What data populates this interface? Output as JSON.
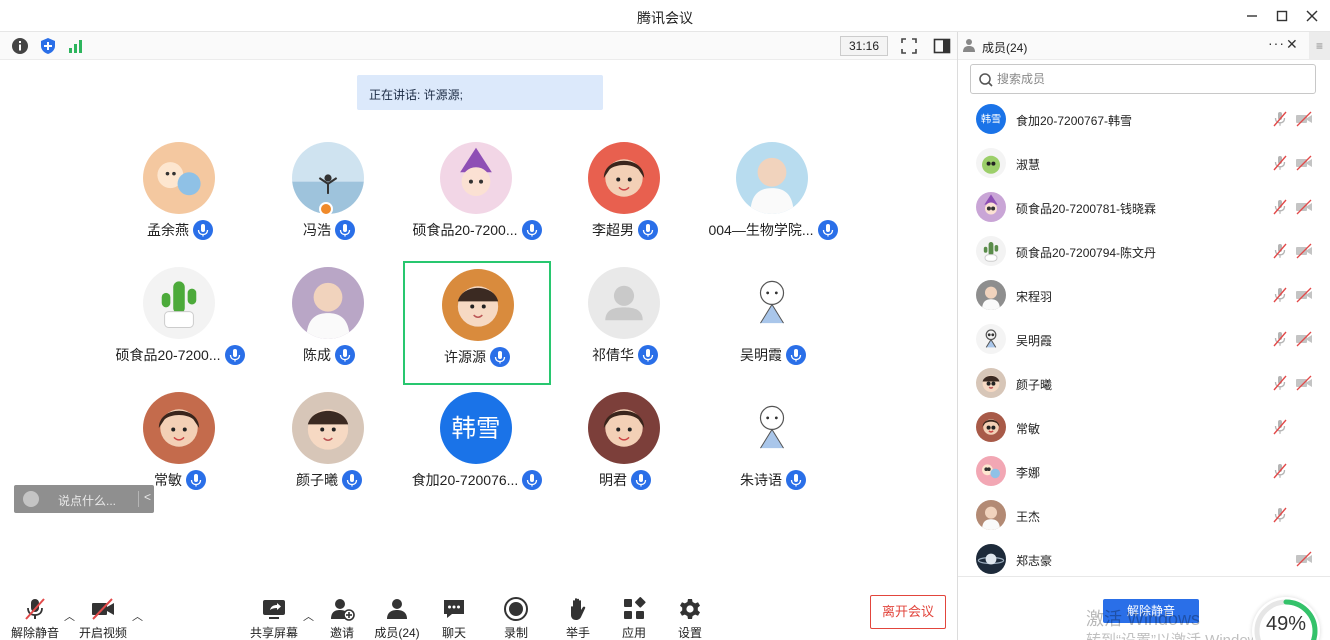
{
  "window": {
    "title": "腾讯会议",
    "controls": [
      "minimize-icon",
      "maximize-icon",
      "close-icon"
    ]
  },
  "topbar": {
    "icons": [
      "info-icon",
      "shield-icon",
      "signal-icon"
    ],
    "timer": "31:16",
    "right_icons": [
      "fullscreen-icon",
      "sidebar-toggle-icon"
    ]
  },
  "speaking": {
    "label": "正在讲话: 许源源;"
  },
  "participants": [
    {
      "name": "孟余燕",
      "avatar": "cartoon",
      "bg": "#f4c8a0"
    },
    {
      "name": "冯浩",
      "avatar": "sea",
      "bg": "#9ec3dc",
      "host": true
    },
    {
      "name": "硕食品20-7200...",
      "avatar": "witch",
      "bg": "#f2d6e6"
    },
    {
      "name": "李超男",
      "avatar": "girl",
      "bg": "#e8604f"
    },
    {
      "name": "004—生物学院...",
      "avatar": "photo",
      "bg": "#b8dcef"
    },
    {
      "name": "硕食品20-7200...",
      "avatar": "cactus",
      "bg": "#4caa3a"
    },
    {
      "name": "陈成",
      "avatar": "photo",
      "bg": "#b9a6c6"
    },
    {
      "name": "许源源",
      "avatar": "baby",
      "bg": "#d98b3d",
      "active": true
    },
    {
      "name": "祁倩华",
      "avatar": "default",
      "bg": "#e9e9e9"
    },
    {
      "name": "吴明霞",
      "avatar": "sketch",
      "bg": "#ffffff"
    },
    {
      "name": "常敏",
      "avatar": "girl",
      "bg": "#c46b4c"
    },
    {
      "name": "颜子曦",
      "avatar": "baby",
      "bg": "#d7c6b8"
    },
    {
      "name": "食加20-720076...",
      "avatar": "text",
      "text": "韩雪",
      "bg": "#1a73e8"
    },
    {
      "name": "明君",
      "avatar": "girl",
      "bg": "#7c3f3a"
    },
    {
      "name": "朱诗语",
      "avatar": "sketch",
      "bg": "#ffffff"
    }
  ],
  "chat": {
    "placeholder": "说点什么...",
    "collapse": "<"
  },
  "bottombar": {
    "unmute": "解除静音",
    "video": "开启视频",
    "share": "共享屏幕",
    "invite": "邀请",
    "members": "成员(24)",
    "chat": "聊天",
    "record": "录制",
    "raise_hand": "举手",
    "apps": "应用",
    "settings": "设置",
    "leave": "离开会议"
  },
  "panel": {
    "title": "成员(24)",
    "more": "···",
    "close": "✕",
    "menu": "≡",
    "search_placeholder": "搜索成员",
    "members": [
      {
        "name": "食加20-7200767-韩雪",
        "avatar": "text",
        "text": "韩雪",
        "bg": "#1a73e8",
        "cam": true
      },
      {
        "name": "淑慧",
        "avatar": "dino",
        "bg": "#9ccf6a",
        "cam": true
      },
      {
        "name": "硕食品20-7200781-钱晓霖",
        "avatar": "witch",
        "bg": "#c9a5d6",
        "cam": true
      },
      {
        "name": "硕食品20-7200794-陈文丹",
        "avatar": "cactus",
        "bg": "#5a8c4a",
        "cam": true
      },
      {
        "name": "宋程羽",
        "avatar": "photo",
        "bg": "#8e8e8e",
        "cam": true
      },
      {
        "name": "吴明霞",
        "avatar": "sketch",
        "bg": "#f4f4f4",
        "cam": true
      },
      {
        "name": "颜子曦",
        "avatar": "baby",
        "bg": "#d7c6b8",
        "cam": true
      },
      {
        "name": "常敏",
        "avatar": "girl",
        "bg": "#a85a48",
        "cam": false
      },
      {
        "name": "李娜",
        "avatar": "cartoon",
        "bg": "#f2a7b4",
        "cam": false
      },
      {
        "name": "王杰",
        "avatar": "photo",
        "bg": "#b38a74",
        "cam": false
      },
      {
        "name": "郑志豪",
        "avatar": "planet",
        "bg": "#1d2a3a",
        "cam": true,
        "mic": false
      }
    ],
    "unmute_all": "解除静音",
    "watermark_line1": "激活 Windows",
    "watermark_line2": "转到“设置”以激活 Windows",
    "gauge_percent": "49%",
    "gauge_value": 49
  },
  "colors": {
    "accent": "#2a6fe8",
    "active_border": "#28c76f",
    "danger": "#e2453c",
    "mute_red": "#e24a4a"
  }
}
